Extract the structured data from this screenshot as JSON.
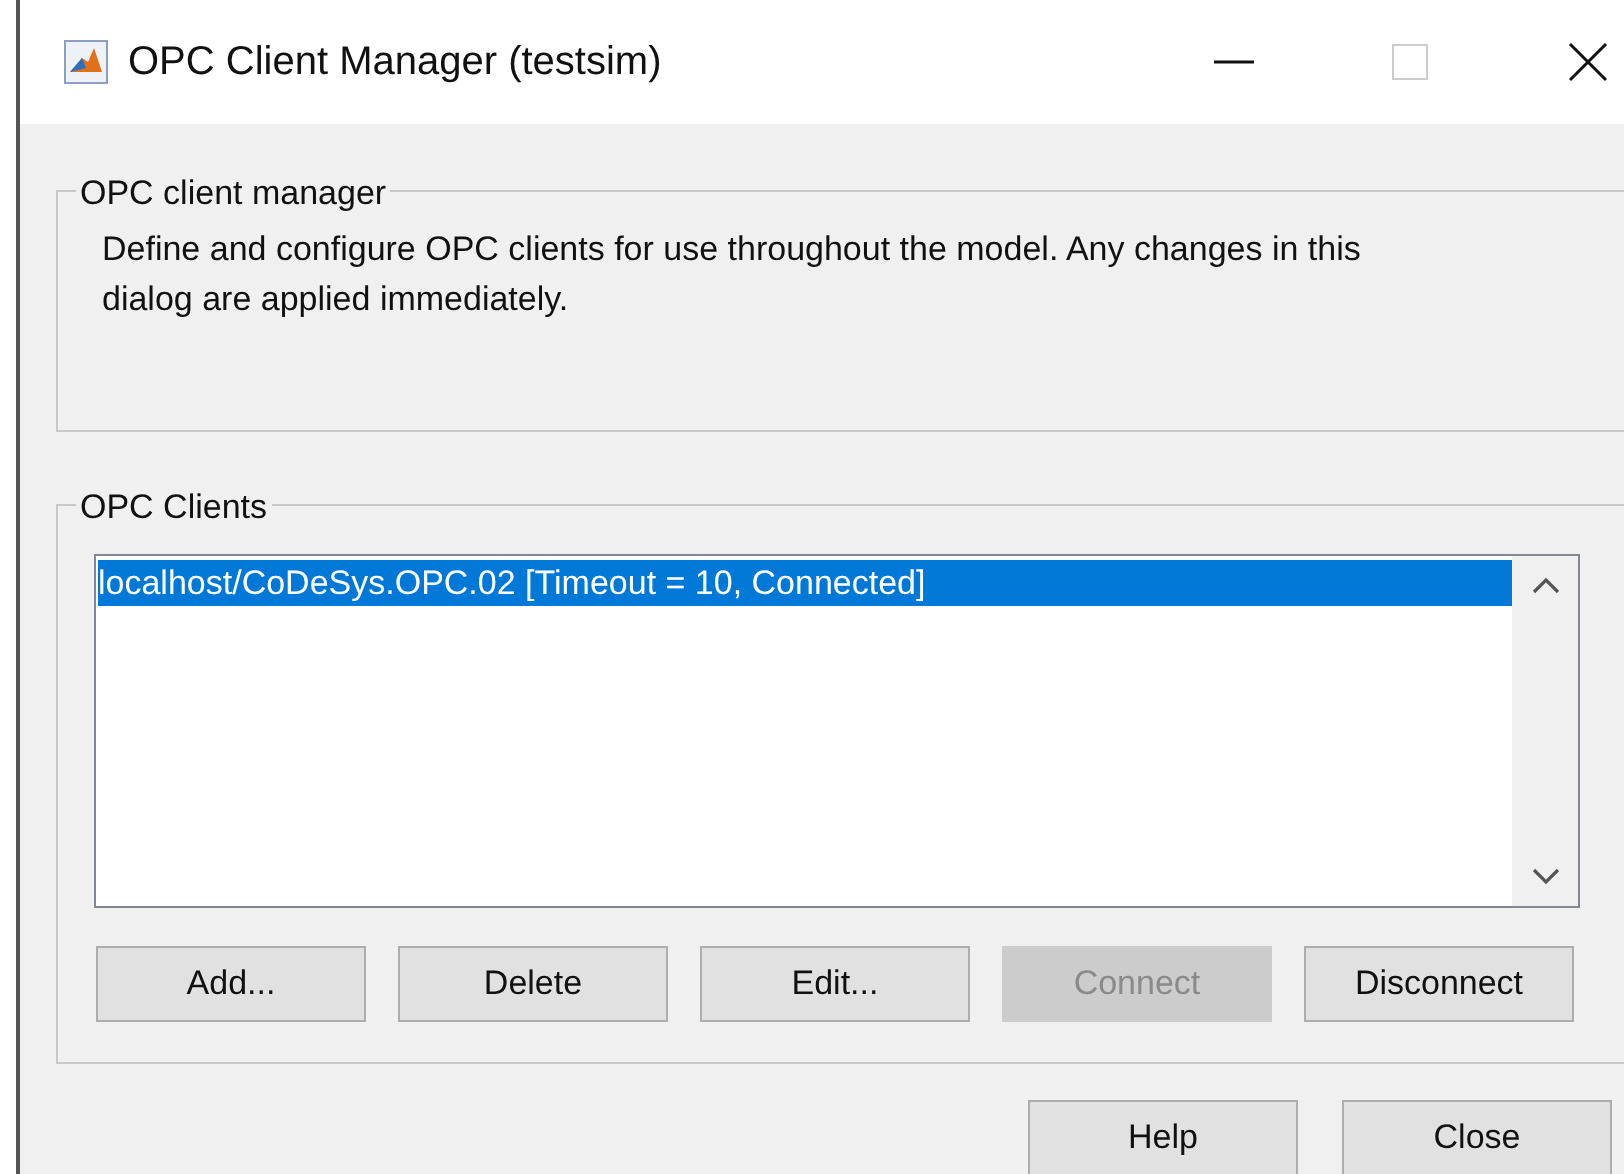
{
  "window": {
    "title": "OPC Client Manager (testsim)"
  },
  "manager_group": {
    "title": "OPC client manager",
    "description": "Define and configure OPC clients for use throughout the model. Any changes in this dialog are applied immediately."
  },
  "clients_group": {
    "title": "OPC Clients",
    "items": [
      {
        "label": "localhost/CoDeSys.OPC.02 [Timeout = 10, Connected]",
        "selected": true
      }
    ],
    "buttons": [
      {
        "label": "Add...",
        "disabled": false
      },
      {
        "label": "Delete",
        "disabled": false
      },
      {
        "label": "Edit...",
        "disabled": false
      },
      {
        "label": "Connect",
        "disabled": true
      },
      {
        "label": "Disconnect",
        "disabled": false
      }
    ]
  },
  "dialog_buttons": [
    {
      "label": "Help"
    },
    {
      "label": "Close"
    }
  ]
}
